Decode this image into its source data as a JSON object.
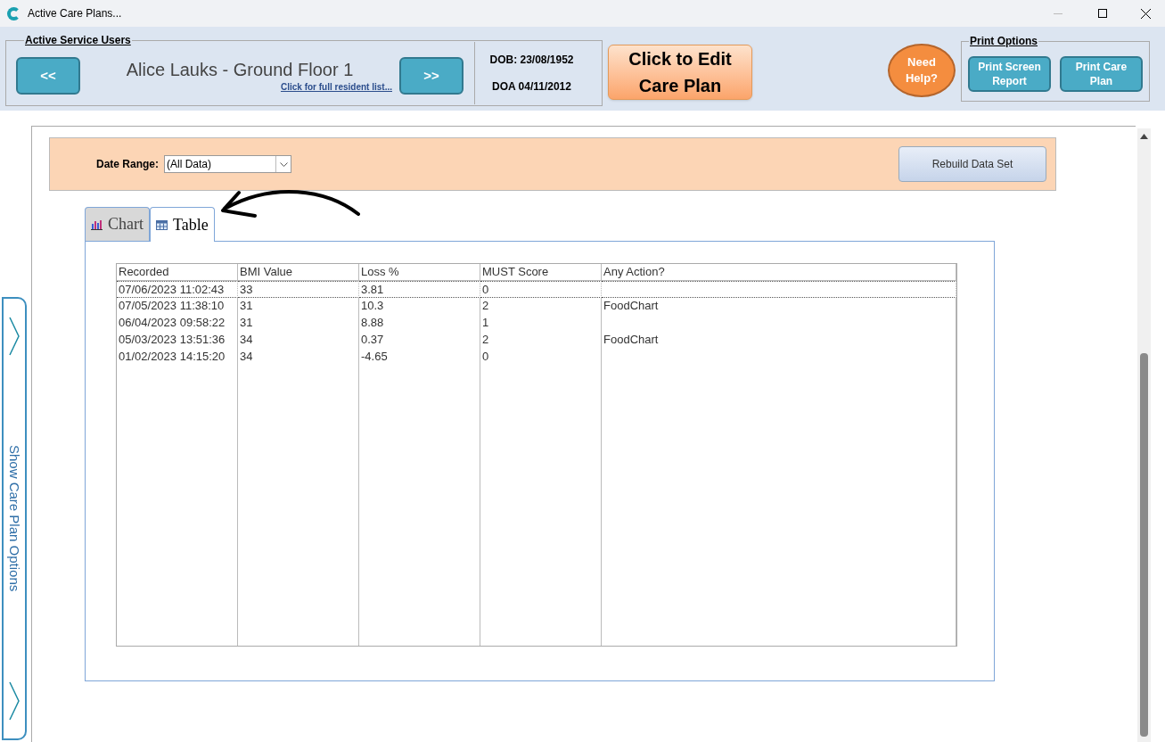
{
  "window": {
    "title": "Active Care Plans..."
  },
  "header": {
    "group_label": "Active Service Users",
    "prev_button": "<<",
    "next_button": ">>",
    "resident": "Alice Lauks - Ground Floor 1",
    "resident_list_link": "Click for full resident list...",
    "dob": "DOB: 23/08/1952",
    "doa": "DOA 04/11/2012",
    "edit_button": "Click to Edit Care Plan",
    "help_button": "Need Help?",
    "print_group_label": "Print Options",
    "print_buttons": [
      "Print Screen Report",
      "Print Care Plan"
    ]
  },
  "side_panel": {
    "label": "Show Care Plan Options"
  },
  "filter": {
    "label": "Date Range:",
    "value": "(All Data)",
    "rebuild_button": "Rebuild Data Set"
  },
  "tabs": [
    {
      "label": "Chart",
      "kind": "chart",
      "selected": false
    },
    {
      "label": "Table",
      "kind": "table",
      "selected": true
    }
  ],
  "table": {
    "columns": [
      "Recorded",
      "BMI Value",
      "Loss %",
      "MUST Score",
      "Any Action?"
    ],
    "rows": [
      {
        "cells": [
          "07/06/2023 11:02:43",
          "33",
          "3.81",
          "0",
          ""
        ],
        "selected": true
      },
      {
        "cells": [
          "07/05/2023 11:38:10",
          "31",
          "10.3",
          "2",
          "FoodChart"
        ],
        "selected": false
      },
      {
        "cells": [
          "06/04/2023 09:58:22",
          "31",
          "8.88",
          "1",
          ""
        ],
        "selected": false
      },
      {
        "cells": [
          "05/03/2023 13:51:36",
          "34",
          "0.37",
          "2",
          "FoodChart"
        ],
        "selected": false
      },
      {
        "cells": [
          "01/02/2023 14:15:20",
          "34",
          "-4.65",
          "0",
          ""
        ],
        "selected": false
      }
    ]
  }
}
